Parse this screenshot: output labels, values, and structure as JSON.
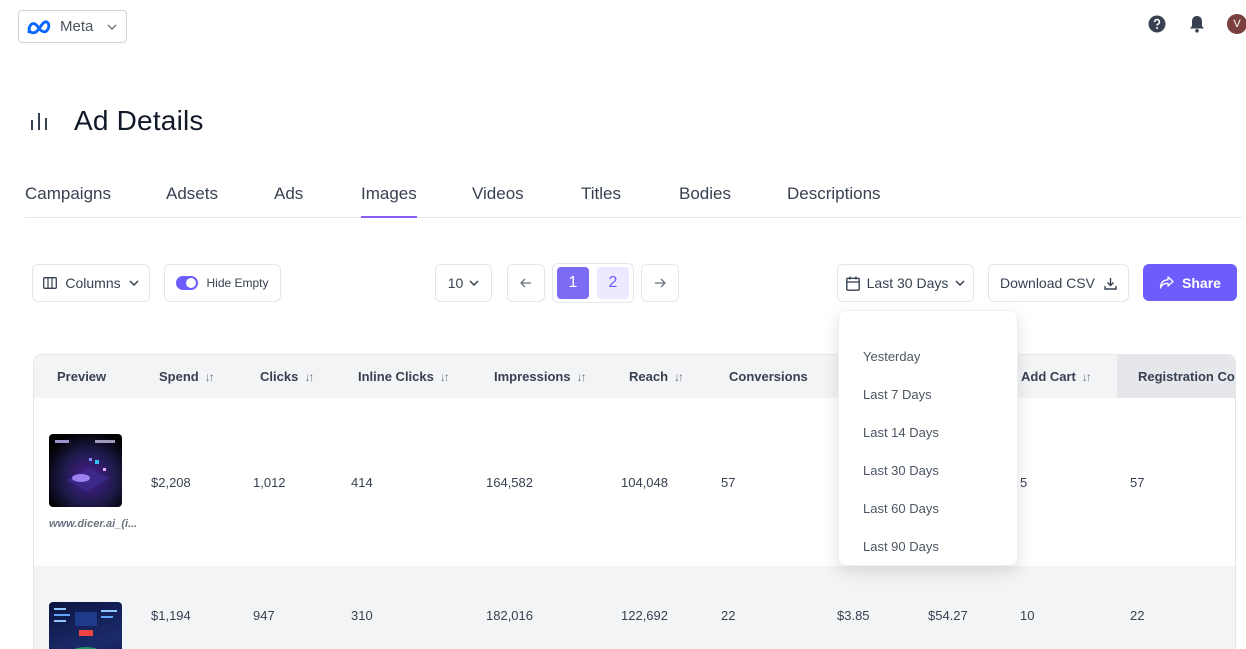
{
  "header": {
    "brand_label": "Meta",
    "avatar_initial": "V"
  },
  "page": {
    "title": "Ad Details"
  },
  "tabs": [
    {
      "label": "Campaigns"
    },
    {
      "label": "Adsets"
    },
    {
      "label": "Ads"
    },
    {
      "label": "Images",
      "active": true
    },
    {
      "label": "Videos"
    },
    {
      "label": "Titles"
    },
    {
      "label": "Bodies"
    },
    {
      "label": "Descriptions"
    }
  ],
  "toolbar": {
    "columns_label": "Columns",
    "hide_empty_label": "Hide Empty",
    "per_page_value": "10",
    "pages": [
      "1",
      "2"
    ],
    "current_page": "1",
    "date_range_label": "Last 30 Days",
    "download_label": "Download CSV",
    "share_label": "Share"
  },
  "date_dropdown": {
    "options": [
      "Yesterday",
      "Last 7 Days",
      "Last 14 Days",
      "Last 30 Days",
      "Last 60 Days",
      "Last 90 Days"
    ]
  },
  "table": {
    "columns": [
      "Preview",
      "Spend",
      "Clicks",
      "Inline Clicks",
      "Impressions",
      "Reach",
      "Conversions",
      "Add Cart",
      "Registration Cor"
    ],
    "rows": [
      {
        "caption": "www.dicer.ai_(i...",
        "spend": "$2,208",
        "clicks": "1,012",
        "inline_clicks": "414",
        "impressions": "164,582",
        "reach": "104,048",
        "conversions": "57",
        "add_cart": "5",
        "registration": "57"
      },
      {
        "spend": "$1,194",
        "clicks": "947",
        "inline_clicks": "310",
        "impressions": "182,016",
        "reach": "122,692",
        "conversions": "22",
        "extra1": "$3.85",
        "extra2": "$54.27",
        "add_cart": "10",
        "registration": "22"
      }
    ]
  },
  "colors": {
    "accent": "#6d5dfc",
    "accent_light": "#ede9fe"
  }
}
